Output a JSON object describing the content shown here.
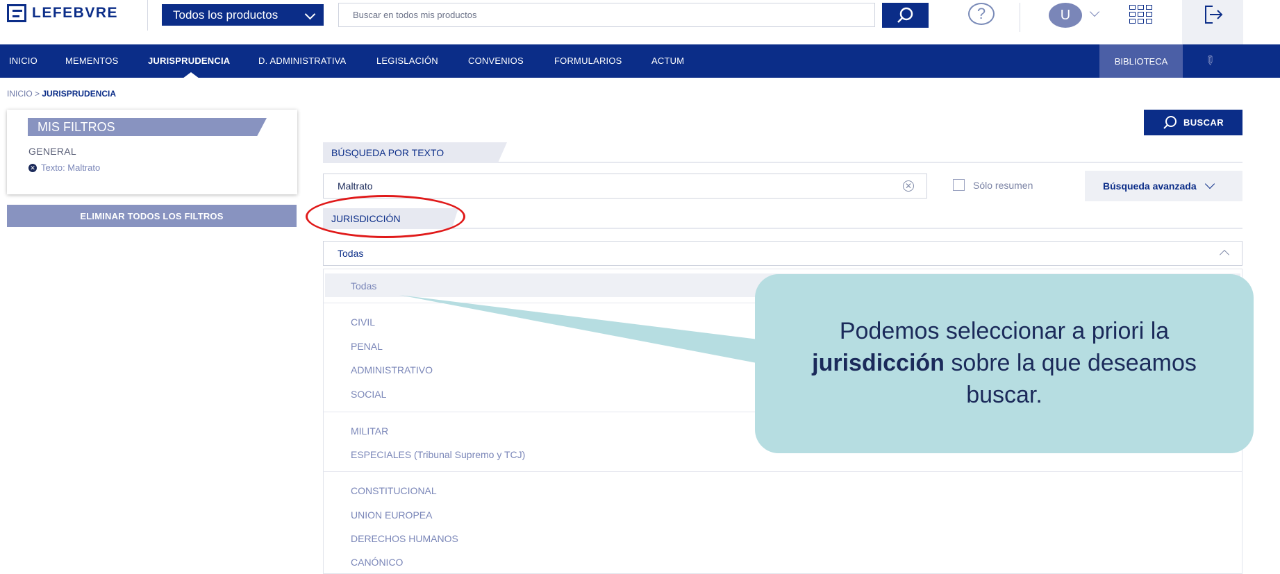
{
  "header": {
    "logo_text": "LEFEBVRE",
    "products_label": "Todos los productos",
    "search_placeholder": "Buscar en todos mis productos",
    "help_symbol": "?",
    "avatar_initial": "U"
  },
  "nav": {
    "items": [
      "INICIO",
      "MEMENTOS",
      "JURISPRUDENCIA",
      "D. ADMINISTRATIVA",
      "LEGISLACIÓN",
      "CONVENIOS",
      "FORMULARIOS",
      "ACTUM"
    ],
    "active": "JURISPRUDENCIA",
    "biblioteca": "BIBLIOTECA"
  },
  "breadcrumb": {
    "root": "INICIO",
    "separator": ">",
    "current": "JURISPRUDENCIA"
  },
  "filters": {
    "title": "MIS FILTROS",
    "general_label": "GENERAL",
    "chip_text": "Texto: Maltrato",
    "clear_all": "ELIMINAR TODOS LOS FILTROS"
  },
  "search": {
    "button_label": "BUSCAR",
    "text_section": "BÚSQUEDA POR TEXTO",
    "text_value": "Maltrato",
    "summary_only": "Sólo resumen",
    "advanced": "Búsqueda avanzada"
  },
  "jurisdiction": {
    "section": "JURISDICCIÓN",
    "selected": "Todas",
    "options": [
      "Todas",
      "CIVIL",
      "PENAL",
      "ADMINISTRATIVO",
      "SOCIAL",
      "MILITAR",
      "ESPECIALES (Tribunal Supremo y TCJ)",
      "CONSTITUCIONAL",
      "UNION EUROPEA",
      "DERECHOS HUMANOS",
      "CANÓNICO"
    ]
  },
  "callout": {
    "text_before": "Podemos seleccionar a priori la",
    "text_bold": "jurisdicción",
    "text_after": "sobre la que deseamos buscar.",
    "color": "#b6dde1"
  },
  "colors": {
    "brand": "#0b2d88",
    "accent_muted": "#8893c0",
    "highlight": "#e01a1a"
  }
}
